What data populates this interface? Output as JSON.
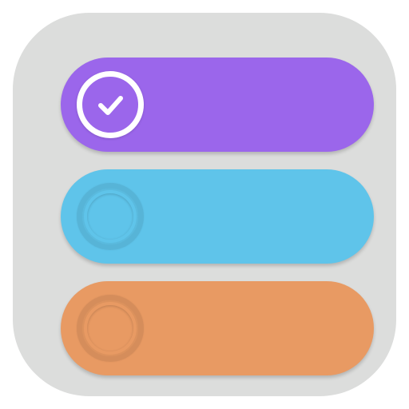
{
  "colors": {
    "background": "#dcdddc",
    "purple": "#9b66eb",
    "blue": "#5fc4ea",
    "orange": "#e89a63",
    "check": "#ffffff"
  },
  "items": [
    {
      "state": "checked",
      "color": "purple",
      "icon": "check-icon"
    },
    {
      "state": "unchecked",
      "color": "blue",
      "icon": "empty-circle-icon"
    },
    {
      "state": "unchecked",
      "color": "orange",
      "icon": "empty-circle-icon"
    }
  ]
}
